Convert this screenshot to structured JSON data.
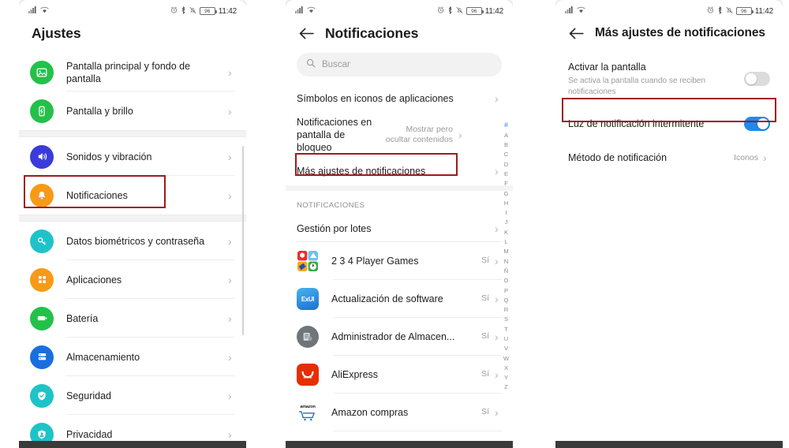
{
  "status_bar": {
    "signal_icon": "signal-bars-icon",
    "wifi_icon": "wifi-icon",
    "alarm_icon": "alarm-clock-icon",
    "bluetooth_icon": "bluetooth-icon",
    "mute_icon": "ringer-off-icon",
    "battery_level": "96",
    "time": "11:42"
  },
  "colors": {
    "accent_blue": "#1a8cf0",
    "highlight_red": "#9e1b1b",
    "index_active": "#2b7de0"
  },
  "screen1": {
    "title": "Ajustes",
    "items": [
      {
        "label": "Pantalla principal y fondo de pantalla",
        "icon": "wallpaper-icon",
        "color": "#23c14a",
        "chevron": "›"
      },
      {
        "label": "Pantalla y brillo",
        "icon": "display-brightness-icon",
        "color": "#23c14a",
        "chevron": "›"
      },
      {
        "label": "Sonidos y vibración",
        "icon": "volume-icon",
        "color": "#3b3bd9",
        "chevron": "›"
      },
      {
        "label": "Notificaciones",
        "icon": "bell-icon",
        "color": "#f79a16",
        "chevron": "›"
      },
      {
        "label": "Datos biométricos y contraseña",
        "icon": "key-icon",
        "color": "#1ec3c8",
        "chevron": "›"
      },
      {
        "label": "Aplicaciones",
        "icon": "apps-grid-icon",
        "color": "#f79a16",
        "chevron": "›"
      },
      {
        "label": "Batería",
        "icon": "battery-icon",
        "color": "#23c14a",
        "chevron": "›"
      },
      {
        "label": "Almacenamiento",
        "icon": "storage-icon",
        "color": "#1a6ee0",
        "chevron": "›"
      },
      {
        "label": "Seguridad",
        "icon": "shield-check-icon",
        "color": "#1ec3c8",
        "chevron": "›"
      },
      {
        "label": "Privacidad",
        "icon": "privacy-shield-icon",
        "color": "#1ec3c8",
        "chevron": "›"
      }
    ],
    "highlighted_item": "Notificaciones"
  },
  "screen2": {
    "title": "Notificaciones",
    "back_icon": "back-arrow-icon",
    "search": {
      "placeholder": "Buscar",
      "icon": "search-icon",
      "value": ""
    },
    "settings_rows": [
      {
        "label": "Símbolos en iconos de aplicaciones",
        "value": "",
        "chevron": "›"
      },
      {
        "label": "Notificaciones en pantalla de bloqueo",
        "value": "Mostrar pero ocultar contenidos",
        "chevron": "›"
      },
      {
        "label": "Más ajustes de notificaciones",
        "value": "",
        "chevron": "›"
      }
    ],
    "section_label": "NOTIFICACIONES",
    "batch_row": {
      "label": "Gestión por lotes",
      "chevron": "›"
    },
    "apps": [
      {
        "name": "2 3 4 Player Games",
        "value": "Sí",
        "icon": "app-234-player-games-icon",
        "chevron": "›"
      },
      {
        "name": "Actualización de software",
        "value": "Sí",
        "icon": "app-hihonor-exui-icon",
        "chevron": "›"
      },
      {
        "name": "Administrador de Almacen...",
        "value": "Sí",
        "icon": "app-storage-manager-icon",
        "chevron": "›"
      },
      {
        "name": "AliExpress",
        "value": "Sí",
        "icon": "app-aliexpress-icon",
        "chevron": "›"
      },
      {
        "name": "Amazon compras",
        "value": "Sí",
        "icon": "app-amazon-icon",
        "chevron": "›"
      }
    ],
    "alpha_index": [
      "#",
      "A",
      "B",
      "C",
      "D",
      "E",
      "F",
      "G",
      "H",
      "I",
      "J",
      "K",
      "L",
      "M",
      "N",
      "Ñ",
      "O",
      "P",
      "Q",
      "R",
      "S",
      "T",
      "U",
      "V",
      "W",
      "X",
      "Y",
      "Z"
    ],
    "highlighted_item": "Más ajustes de notificaciones"
  },
  "screen3": {
    "title": "Más ajustes de notificaciones",
    "back_icon": "back-arrow-icon",
    "rows": [
      {
        "label": "Activar la pantalla",
        "sub": "Se activa la pantalla cuando se reciben notificaciones",
        "control": "toggle",
        "toggle_on": false
      },
      {
        "label": "Luz de notificación intermitente",
        "sub": "",
        "control": "toggle",
        "toggle_on": true
      },
      {
        "label": "Método de notificación",
        "sub": "",
        "control": "value",
        "value": "Iconos",
        "chevron": "›"
      }
    ],
    "highlighted_item": "Luz de notificación intermitente"
  }
}
